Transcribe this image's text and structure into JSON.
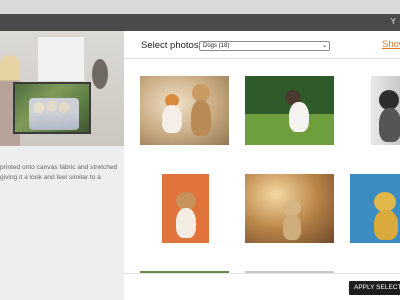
{
  "background_page": {
    "corner_text": "Y",
    "description_text": "printed onto canvas fabric and stretched giving it a look and feel similar to a"
  },
  "modal": {
    "title": "Select photos",
    "album_select": {
      "selected": "Dogs (18)"
    },
    "show_link": "Show",
    "photos": [
      {
        "id": 1,
        "subject": "two small dogs on a dirt path"
      },
      {
        "id": 2,
        "subject": "dog on green grass"
      },
      {
        "id": 3,
        "subject": "dog in grey cap"
      },
      {
        "id": 4,
        "subject": "corgi puppy on orange background"
      },
      {
        "id": 5,
        "subject": "puppy in autumn forest"
      },
      {
        "id": 6,
        "subject": "dog on blue background"
      }
    ],
    "apply_button": "APPLY SELECTI"
  },
  "colors": {
    "accent_link": "#e07b2a",
    "apply_button_bg": "#1e1e1e",
    "dark_bar": "#4a4a4a"
  }
}
